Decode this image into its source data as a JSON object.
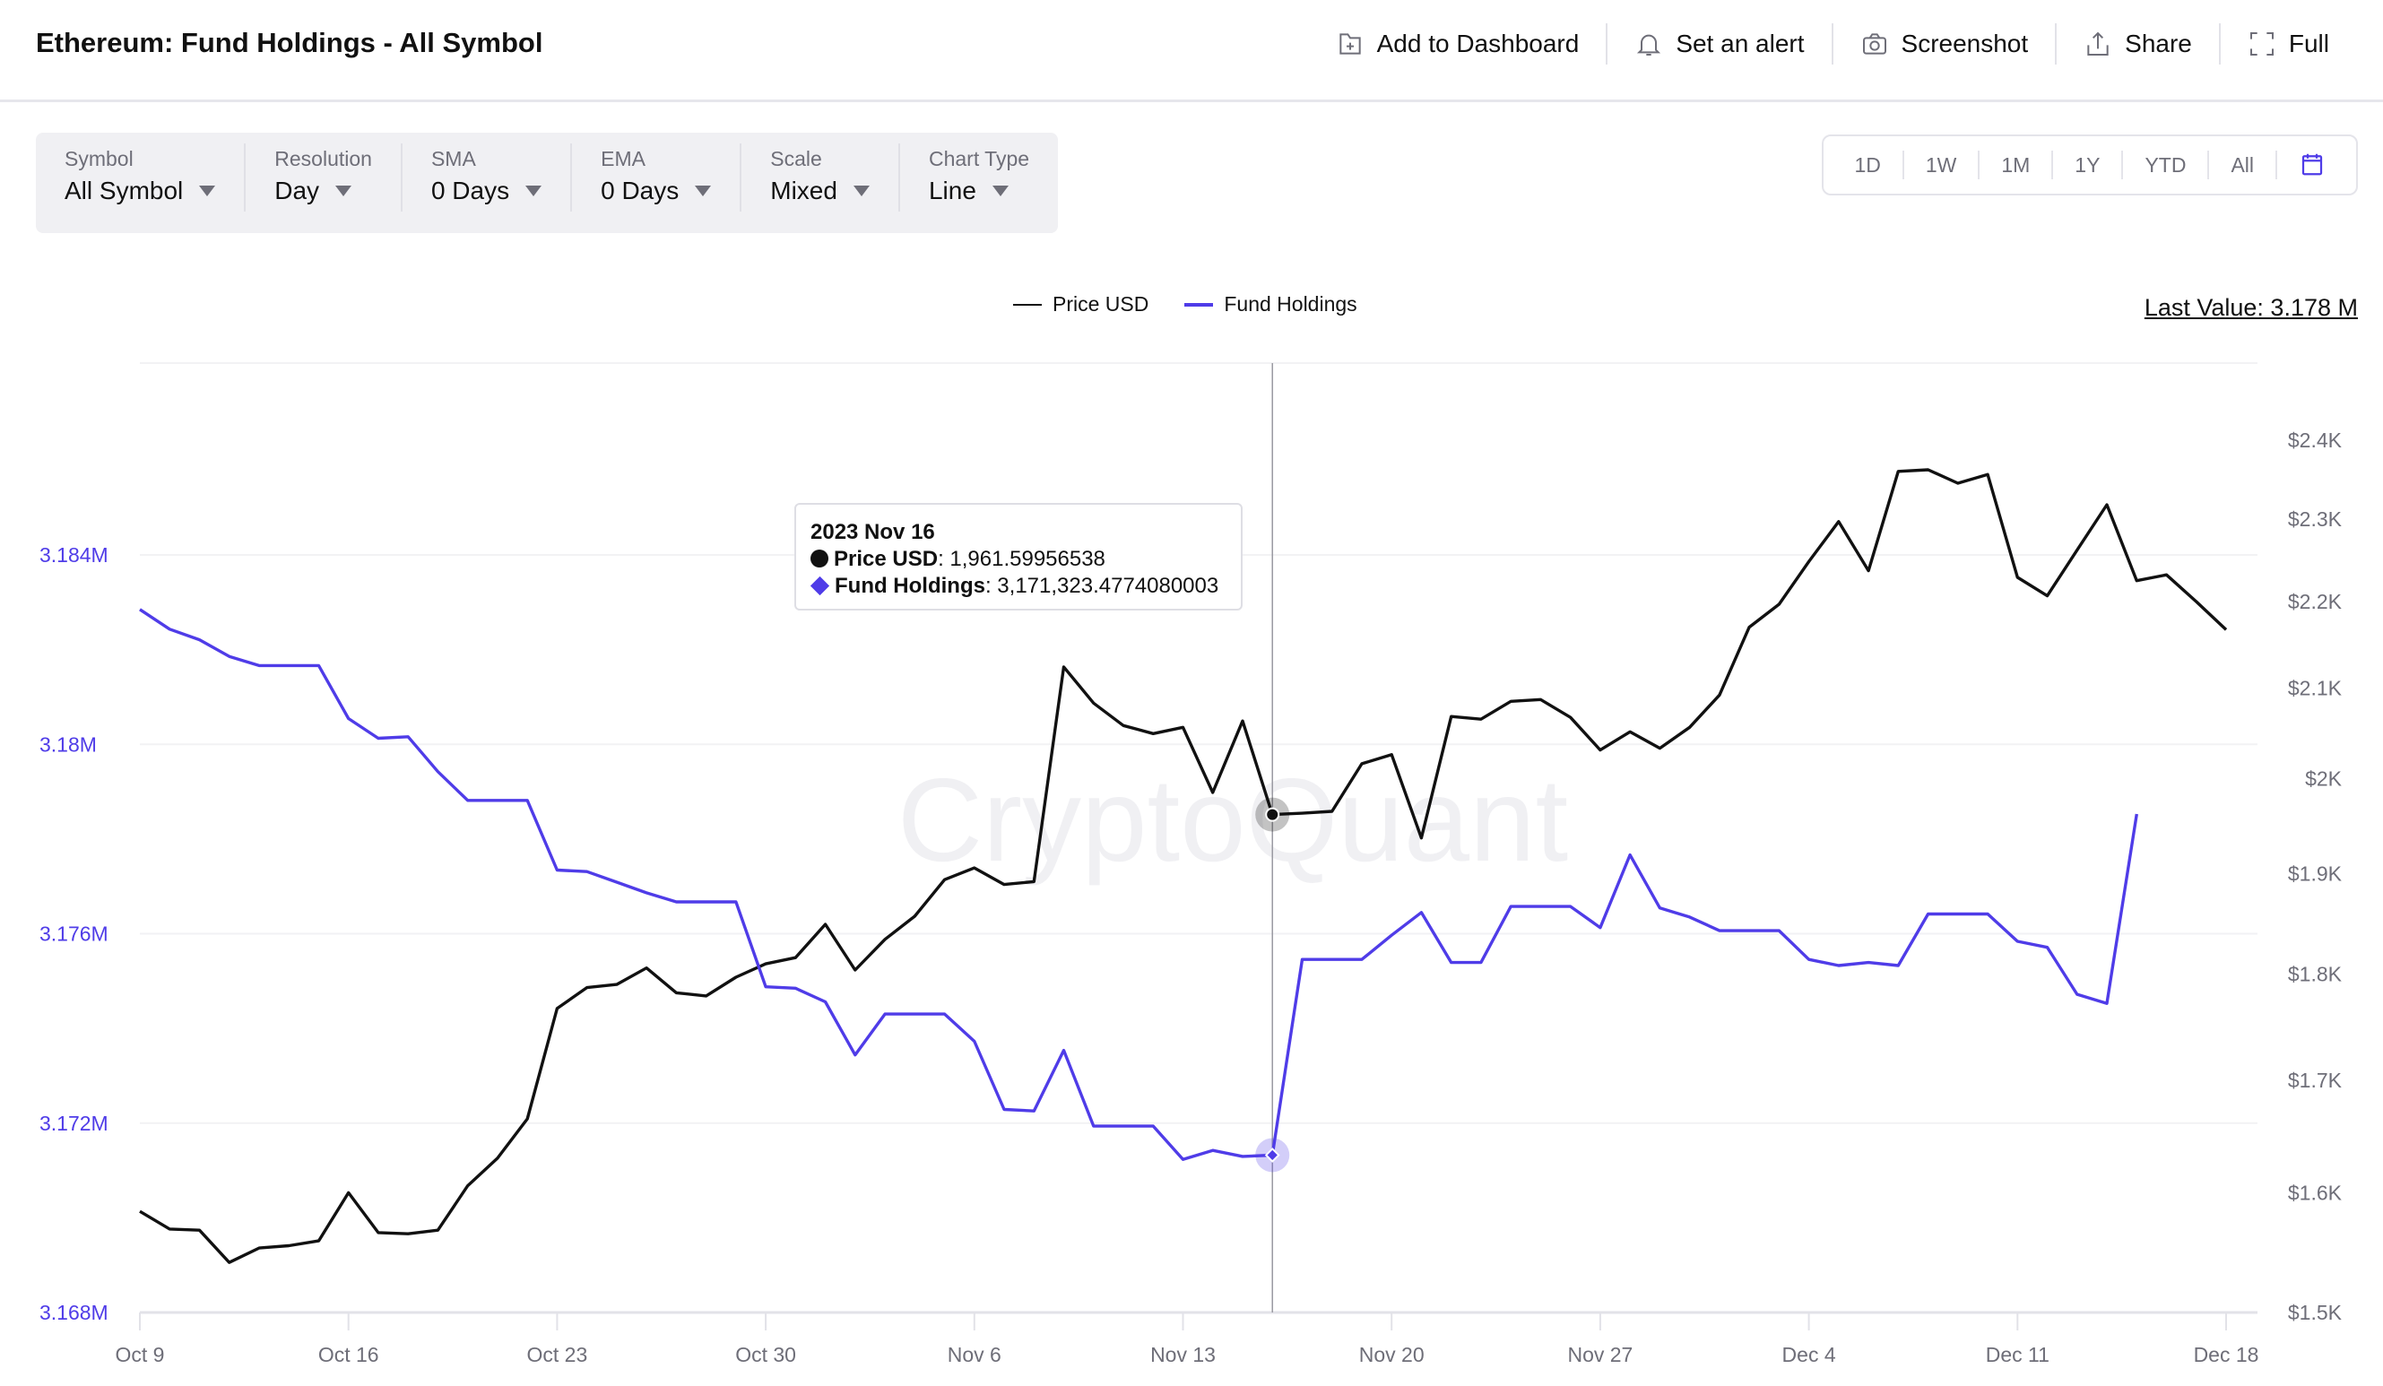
{
  "header": {
    "title": "Ethereum: Fund Holdings - All Symbol",
    "actions": [
      {
        "label": "Add to Dashboard",
        "icon": "add-dashboard-icon"
      },
      {
        "label": "Set an alert",
        "icon": "bell-icon"
      },
      {
        "label": "Screenshot",
        "icon": "camera-icon"
      },
      {
        "label": "Share",
        "icon": "share-icon"
      },
      {
        "label": "Full",
        "icon": "fullscreen-icon"
      }
    ]
  },
  "filters": [
    {
      "label": "Symbol",
      "value": "All Symbol"
    },
    {
      "label": "Resolution",
      "value": "Day"
    },
    {
      "label": "SMA",
      "value": "0 Days"
    },
    {
      "label": "EMA",
      "value": "0 Days"
    },
    {
      "label": "Scale",
      "value": "Mixed"
    },
    {
      "label": "Chart Type",
      "value": "Line"
    }
  ],
  "ranges": [
    "1D",
    "1W",
    "1M",
    "1Y",
    "YTD",
    "All"
  ],
  "last_value": "Last Value: 3.178 M",
  "watermark": "CryptoQuant",
  "tooltip": {
    "date": "2023 Nov 16",
    "price_label": "Price USD",
    "price_value": ": 1,961.59956538",
    "fund_label": "Fund Holdings",
    "fund_value": ": 3,171,323.4774080003"
  },
  "colors": {
    "price": "#111111",
    "fund": "#4f3ce8",
    "left_axis": "#4f3ce8",
    "right_axis": "#6e6e78"
  },
  "chart_data": {
    "type": "line",
    "title": "Ethereum: Fund Holdings - All Symbol",
    "x_start": "2023-10-09",
    "x_step": "1 day",
    "x_ticks": [
      "Oct 9",
      "Oct 16",
      "Oct 23",
      "Oct 30",
      "Nov 6",
      "Nov 13",
      "Nov 20",
      "Nov 27",
      "Dec 4",
      "Dec 11",
      "Dec 18"
    ],
    "legend": [
      "Price USD",
      "Fund Holdings"
    ],
    "legend_position": "top-center",
    "grid": true,
    "hover_date": "2023 Nov 16",
    "left_axis": {
      "label": "Fund Holdings",
      "scale": "linear",
      "range": [
        3168000,
        3186500
      ],
      "ticks": [
        "3.168M",
        "3.172M",
        "3.176M",
        "3.18M",
        "3.184M"
      ],
      "tick_values": [
        3168000,
        3172000,
        3176000,
        3180000,
        3184000
      ]
    },
    "right_axis": {
      "label": "Price USD",
      "scale": "log",
      "range": [
        1500,
        2500
      ],
      "ticks": [
        "$1.5K",
        "$1.6K",
        "$1.7K",
        "$1.8K",
        "$1.9K",
        "$2K",
        "$2.1K",
        "$2.2K",
        "$2.3K",
        "$2.4K"
      ],
      "tick_values": [
        1500,
        1600,
        1700,
        1800,
        1900,
        2000,
        2100,
        2200,
        2300,
        2400
      ]
    },
    "series": [
      {
        "name": "Price USD",
        "axis": "right",
        "values": [
          1584,
          1569,
          1568,
          1541,
          1553,
          1555,
          1559,
          1600,
          1566,
          1565,
          1568,
          1606,
          1630,
          1665,
          1767,
          1787,
          1790,
          1806,
          1782,
          1779,
          1797,
          1810,
          1816,
          1849,
          1804,
          1834,
          1857,
          1894,
          1906,
          1889,
          1892,
          2124,
          2083,
          2058,
          2049,
          2056,
          1985,
          2063,
          1961.6,
          1963,
          1965,
          2016,
          2026,
          1937,
          2068,
          2065,
          2085,
          2087,
          2067,
          2031,
          2051,
          2033,
          2056,
          2092,
          2170,
          2197,
          2248,
          2297,
          2237,
          2360,
          2362,
          2345,
          2356,
          2229,
          2207,
          2262,
          2318,
          2225,
          2232,
          2200,
          2167
        ]
      },
      {
        "name": "Fund Holdings",
        "axis": "left",
        "values": [
          3182848,
          3182432,
          3182208,
          3181856,
          3181664,
          3181664,
          3181664,
          3180544,
          3180128,
          3180160,
          3179424,
          3178816,
          3178816,
          3178816,
          3177344,
          3177312,
          3177088,
          3176864,
          3176672,
          3176672,
          3176672,
          3174880,
          3174848,
          3174560,
          3173440,
          3174304,
          3174304,
          3174304,
          3173728,
          3172288,
          3172256,
          3173536,
          3171936,
          3171936,
          3171936,
          3171232,
          3171424,
          3171296,
          3171323.48,
          3175456,
          3175456,
          3175456,
          3175968,
          3176448,
          3175392,
          3175392,
          3176576,
          3176576,
          3176576,
          3176128,
          3177664,
          3176544,
          3176352,
          3176064,
          3176064,
          3176064,
          3175456,
          3175328,
          3175392,
          3175328,
          3176416,
          3176416,
          3176416,
          3175840,
          3175712,
          3174720,
          3174528,
          3178528
        ]
      }
    ]
  }
}
